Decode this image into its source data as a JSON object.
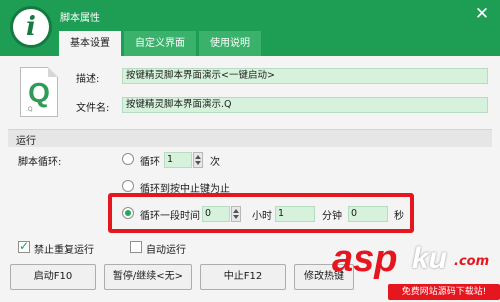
{
  "window": {
    "title": "脚本属性",
    "logo_glyph": "i"
  },
  "tabs": [
    {
      "label": "基本设置",
      "active": true
    },
    {
      "label": "自定义界面",
      "active": false
    },
    {
      "label": "使用说明",
      "active": false
    }
  ],
  "script_file": {
    "icon_letter": "Q",
    "icon_ext": ".Q"
  },
  "fields": {
    "description": {
      "label": "描述:",
      "value": "按键精灵脚本界面演示<一键启动>"
    },
    "filename": {
      "label": "文件名:",
      "value": "按键精灵脚本界面演示.Q"
    }
  },
  "run_section": {
    "title": "运行",
    "loop_label": "脚本循环:",
    "options": {
      "loop_count": {
        "label": "循环",
        "value": "1",
        "unit": "次",
        "selected": false
      },
      "until_stop": {
        "label": "循环到按中止键为止",
        "selected": false
      },
      "duration": {
        "label": "循环一段时间",
        "selected": true,
        "hours": "0",
        "hours_unit": "小时",
        "minutes": "1",
        "minutes_unit": "分钟",
        "seconds": "0",
        "seconds_unit": "秒"
      }
    }
  },
  "checkboxes": {
    "no_repeat": {
      "label": "禁止重复运行",
      "checked": true
    },
    "auto_run": {
      "label": "自动运行",
      "checked": false
    }
  },
  "buttons": {
    "start": "启动F10",
    "pause": "暂停/继续<无>",
    "stop": "中止F12",
    "hotkey": "修改热键"
  },
  "watermark": {
    "brand_red": "asp",
    "brand_white": "ku",
    "tld": ".com",
    "tagline": "免费网站源码下载站!"
  },
  "colors": {
    "title_green": "#1e9e55",
    "field_green": "#d6f2dd",
    "highlight_red": "#e6161f"
  }
}
